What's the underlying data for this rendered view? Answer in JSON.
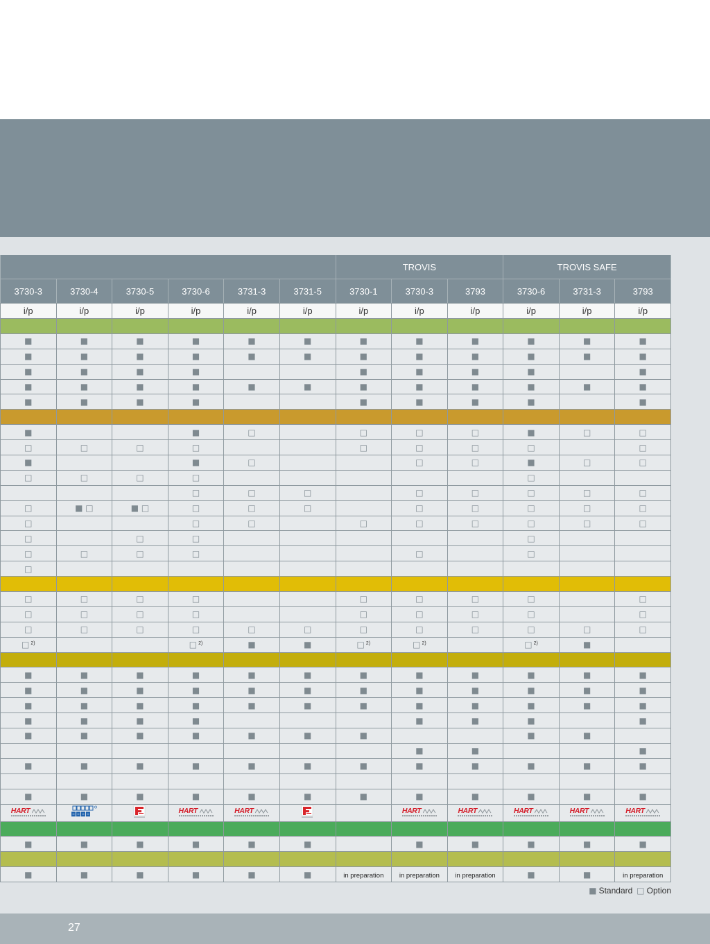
{
  "page": {
    "number": "27"
  },
  "table": {
    "groups": [
      "TROVIS",
      "TROVIS SAFE"
    ],
    "models": [
      "3730-3",
      "3730-4",
      "3730-5",
      "3730-6",
      "3731-3",
      "3731-5",
      "3730-1",
      "3730-3",
      "3793",
      "3730-6",
      "3731-3",
      "3793"
    ],
    "signal": [
      "i/p",
      "i/p",
      "i/p",
      "i/p",
      "i/p",
      "i/p",
      "i/p",
      "i/p",
      "i/p",
      "i/p",
      "i/p",
      "i/p"
    ],
    "sections": [
      {
        "color": "#9bbb5f",
        "rows": [
          [
            "■",
            "■",
            "■",
            "■",
            "■",
            "■",
            "■",
            "■",
            "■",
            "■",
            "■",
            "■"
          ],
          [
            "■",
            "■",
            "■",
            "■",
            "■",
            "■",
            "■",
            "■",
            "■",
            "■",
            "■",
            "■"
          ],
          [
            "■",
            "■",
            "■",
            "■",
            "",
            "",
            "■",
            "■",
            "■",
            "■",
            "",
            "■"
          ],
          [
            "■",
            "■",
            "■",
            "■",
            "■",
            "■",
            "■",
            "■",
            "■",
            "■",
            "■",
            "■"
          ],
          [
            "■",
            "■",
            "■",
            "■",
            "",
            "",
            "■",
            "■",
            "■",
            "■",
            "",
            "■"
          ]
        ]
      },
      {
        "color": "#c99a2d",
        "rows": [
          [
            "■",
            "",
            "",
            "■",
            "□",
            "",
            "□",
            "□",
            "□",
            "■",
            "□",
            "□"
          ],
          [
            "□",
            "□",
            "□",
            "□",
            "",
            "",
            "□",
            "□",
            "□",
            "□",
            "",
            "□"
          ],
          [
            "■",
            "",
            "",
            "■",
            "□",
            "",
            "",
            "□",
            "□",
            "■",
            "□",
            "□"
          ],
          [
            "□",
            "□",
            "□",
            "□",
            "",
            "",
            "",
            "",
            "",
            "□",
            "",
            ""
          ],
          [
            "",
            "",
            "",
            "□",
            "□",
            "□",
            "",
            "□",
            "□",
            "□",
            "□",
            "□"
          ],
          [
            "□",
            "■ □",
            "■ □",
            "□",
            "□",
            "□",
            "",
            "□",
            "□",
            "□",
            "□",
            "□"
          ],
          [
            "□",
            "",
            "",
            "□",
            "□",
            "",
            "□",
            "□",
            "□",
            "□",
            "□",
            "□"
          ],
          [
            "□",
            "",
            "□",
            "□",
            "",
            "",
            "",
            "",
            "",
            "□",
            "",
            ""
          ],
          [
            "□",
            "□",
            "□",
            "□",
            "",
            "",
            "",
            "□",
            "",
            "□",
            "",
            ""
          ],
          [
            "□",
            "",
            "",
            "",
            "",
            "",
            "",
            "",
            "",
            "",
            "",
            ""
          ]
        ]
      },
      {
        "color": "#e1bd06",
        "rows": [
          [
            "□",
            "□",
            "□",
            "□",
            "",
            "",
            "□",
            "□",
            "□",
            "□",
            "",
            "□"
          ],
          [
            "□",
            "□",
            "□",
            "□",
            "",
            "",
            "□",
            "□",
            "□",
            "□",
            "",
            "□"
          ],
          [
            "□",
            "□",
            "□",
            "□",
            "□",
            "□",
            "□",
            "□",
            "□",
            "□",
            "□",
            "□"
          ],
          [
            {
              "mark": "□",
              "note": "2)"
            },
            "",
            "",
            {
              "mark": "□",
              "note": "2)"
            },
            "■",
            "■",
            {
              "mark": "□",
              "note": "2)"
            },
            {
              "mark": "□",
              "note": "2)"
            },
            "",
            {
              "mark": "□",
              "note": "2)"
            },
            "■",
            ""
          ]
        ]
      },
      {
        "color": "#c3ae0c",
        "rows": [
          [
            "■",
            "■",
            "■",
            "■",
            "■",
            "■",
            "■",
            "■",
            "■",
            "■",
            "■",
            "■"
          ],
          [
            "■",
            "■",
            "■",
            "■",
            "■",
            "■",
            "■",
            "■",
            "■",
            "■",
            "■",
            "■"
          ],
          [
            "■",
            "■",
            "■",
            "■",
            "■",
            "■",
            "■",
            "■",
            "■",
            "■",
            "■",
            "■"
          ],
          [
            "■",
            "■",
            "■",
            "■",
            "",
            "",
            "",
            "■",
            "■",
            "■",
            "",
            "■"
          ],
          [
            "■",
            "■",
            "■",
            "■",
            "■",
            "■",
            "■",
            "",
            "",
            "■",
            "■",
            ""
          ],
          [
            "",
            "",
            "",
            "",
            "",
            "",
            "",
            "■",
            "■",
            "",
            "",
            "■"
          ],
          [
            "■",
            "■",
            "■",
            "■",
            "■",
            "■",
            "■",
            "■",
            "■",
            "■",
            "■",
            "■"
          ],
          [
            "",
            "",
            "",
            "",
            "",
            "",
            "",
            "",
            "",
            "",
            "",
            ""
          ],
          [
            "■",
            "■",
            "■",
            "■",
            "■",
            "■",
            "■",
            "■",
            "■",
            "■",
            "■",
            "■"
          ],
          [
            {
              "logo": "hart-logo"
            },
            {
              "logo": "profibus-logo"
            },
            {
              "logo": "fieldbus-logo"
            },
            {
              "logo": "hart-logo"
            },
            {
              "logo": "hart-logo"
            },
            {
              "logo": "fieldbus-logo"
            },
            "",
            {
              "logo": "hart-logo"
            },
            {
              "logo": "hart-logo"
            },
            {
              "logo": "hart-logo"
            },
            {
              "logo": "hart-logo"
            },
            {
              "logo": "hart-logo"
            }
          ]
        ]
      },
      {
        "color": "#4bab5b",
        "rows": [
          [
            "■",
            "■",
            "■",
            "■",
            "■",
            "■",
            "",
            "■",
            "■",
            "■",
            "■",
            "■"
          ]
        ]
      },
      {
        "color": "#b4bd4f",
        "rows": [
          [
            "■",
            "■",
            "■",
            "■",
            "■",
            "■",
            "in preparation",
            "in preparation",
            "in preparation",
            "■",
            "■",
            "in preparation"
          ]
        ]
      }
    ]
  },
  "logos": {
    "hart_lettering": "HART"
  },
  "legend": {
    "standard_symbol": "■",
    "standard_label": "Standard",
    "option_symbol": "□",
    "option_label": "Option"
  },
  "colors": {
    "banner": "#7f8f98",
    "background": "#dfe3e6",
    "footer": "#a9b3b8",
    "mark": "#7f8a90",
    "hart_red": "#d41e2a",
    "profibus_blue": "#2163ad",
    "fieldbus_red": "#d9252b"
  }
}
